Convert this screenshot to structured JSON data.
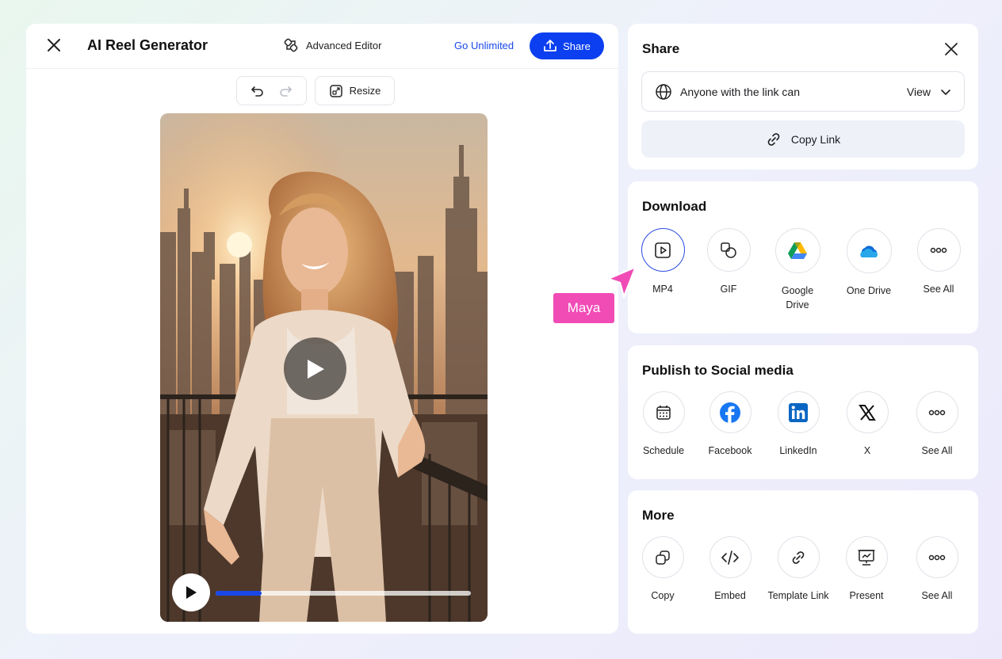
{
  "editor": {
    "title": "AI Reel Generator",
    "advanced_editor": "Advanced Editor",
    "go_unlimited": "Go Unlimited",
    "share": "Share",
    "resize": "Resize",
    "playback_progress": 0.18
  },
  "share_panel": {
    "title": "Share",
    "access_label": "Anyone with the link can",
    "access_value": "View",
    "copy_link": "Copy Link"
  },
  "download": {
    "title": "Download",
    "items": [
      {
        "label": "MP4",
        "icon": "play-box-icon"
      },
      {
        "label": "GIF",
        "icon": "gif-shapes-icon"
      },
      {
        "label": "Google\nDrive",
        "icon": "google-drive-icon"
      },
      {
        "label": "One Drive",
        "icon": "onedrive-icon"
      },
      {
        "label": "See All",
        "icon": "more-dots-icon"
      }
    ]
  },
  "social": {
    "title": "Publish to Social media",
    "items": [
      {
        "label": "Schedule",
        "icon": "calendar-icon"
      },
      {
        "label": "Facebook",
        "icon": "facebook-icon"
      },
      {
        "label": "LinkedIn",
        "icon": "linkedin-icon"
      },
      {
        "label": "X",
        "icon": "x-logo-icon"
      },
      {
        "label": "See All",
        "icon": "more-dots-icon"
      }
    ]
  },
  "more": {
    "title": "More",
    "items": [
      {
        "label": "Copy",
        "icon": "copy-icon"
      },
      {
        "label": "Embed",
        "icon": "code-icon"
      },
      {
        "label": "Template Link",
        "icon": "link-icon"
      },
      {
        "label": "Present",
        "icon": "presentation-icon"
      },
      {
        "label": "See All",
        "icon": "more-dots-icon"
      }
    ]
  },
  "collaborator": {
    "name": "Maya",
    "color": "#f14bb6"
  },
  "colors": {
    "accent": "#0b3ff0"
  }
}
